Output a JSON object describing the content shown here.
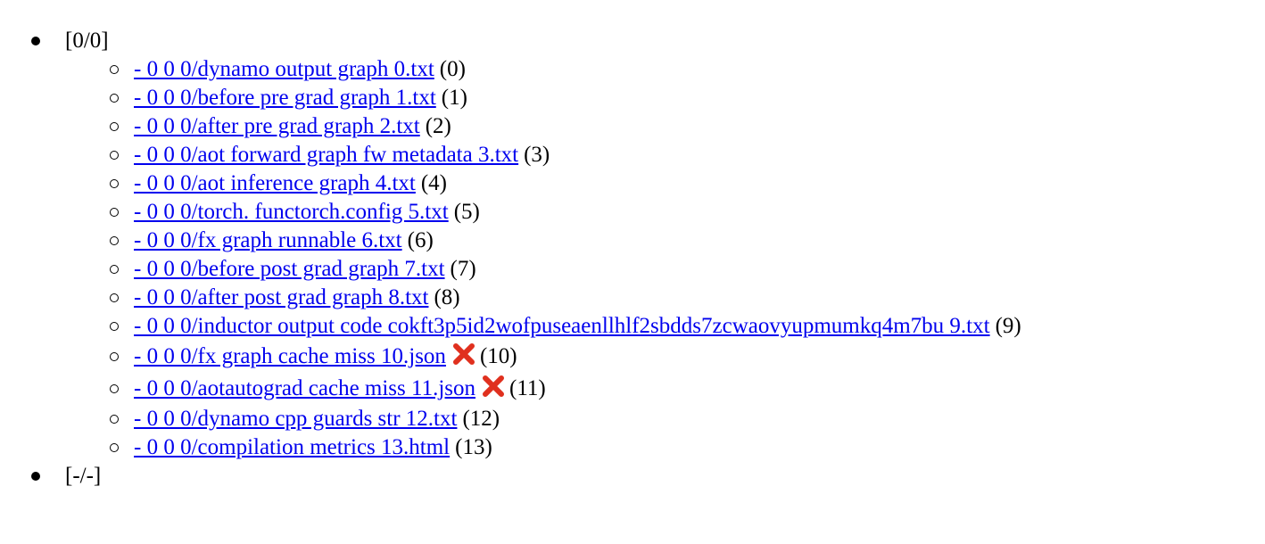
{
  "groups": [
    {
      "label": "[0/0]",
      "items": [
        {
          "text": "- 0 0 0/dynamo output graph 0.txt",
          "index": "(0)",
          "cache_miss": false
        },
        {
          "text": "- 0 0 0/before pre grad graph 1.txt",
          "index": "(1)",
          "cache_miss": false
        },
        {
          "text": "- 0 0 0/after pre grad graph 2.txt",
          "index": "(2)",
          "cache_miss": false
        },
        {
          "text": "- 0 0 0/aot forward graph fw metadata 3.txt",
          "index": "(3)",
          "cache_miss": false
        },
        {
          "text": "- 0 0 0/aot inference graph 4.txt",
          "index": "(4)",
          "cache_miss": false
        },
        {
          "text": "- 0 0 0/torch. functorch.config 5.txt",
          "index": "(5)",
          "cache_miss": false
        },
        {
          "text": "- 0 0 0/fx graph runnable 6.txt",
          "index": "(6)",
          "cache_miss": false
        },
        {
          "text": "- 0 0 0/before post grad graph 7.txt",
          "index": "(7)",
          "cache_miss": false
        },
        {
          "text": "- 0 0 0/after post grad graph 8.txt",
          "index": "(8)",
          "cache_miss": false
        },
        {
          "text": "- 0 0 0/inductor output code cokft3p5id2wofpuseaenllhlf2sbdds7zcwaovyupmumkq4m7bu 9.txt",
          "index": "(9)",
          "cache_miss": false
        },
        {
          "text": "- 0 0 0/fx graph cache miss 10.json",
          "index": "(10)",
          "cache_miss": true
        },
        {
          "text": "- 0 0 0/aotautograd cache miss 11.json",
          "index": "(11)",
          "cache_miss": true
        },
        {
          "text": "- 0 0 0/dynamo cpp guards str 12.txt",
          "index": "(12)",
          "cache_miss": false
        },
        {
          "text": "- 0 0 0/compilation metrics 13.html",
          "index": "(13)",
          "cache_miss": false
        }
      ]
    },
    {
      "label": "[-/-]",
      "items": []
    }
  ],
  "icons": {
    "miss_icon": "cross-mark-icon",
    "miss_color": "#e0301e"
  },
  "colors": {
    "link": "#0000ee",
    "text": "#000000"
  }
}
